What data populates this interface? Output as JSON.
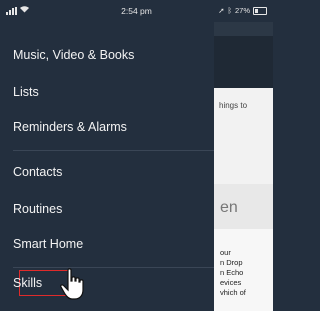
{
  "status_bar": {
    "time": "2:54 pm",
    "battery": "27%"
  },
  "menu": {
    "items": [
      {
        "label": "Music, Video & Books"
      },
      {
        "label": "Lists"
      },
      {
        "label": "Reminders & Alarms"
      },
      {
        "label": "Contacts"
      },
      {
        "label": "Routines"
      },
      {
        "label": "Smart Home"
      },
      {
        "label": "Skills"
      }
    ],
    "highlighted_item": "Skills"
  },
  "background": {
    "snippet_1": "hings to",
    "snippet_2": "en",
    "snippet_lines": [
      "our",
      "n Drop",
      "n Echo",
      "evices",
      "vhich of"
    ]
  },
  "colors": {
    "drawer_bg": "#232f3e",
    "highlight_border": "#e02b2b"
  }
}
